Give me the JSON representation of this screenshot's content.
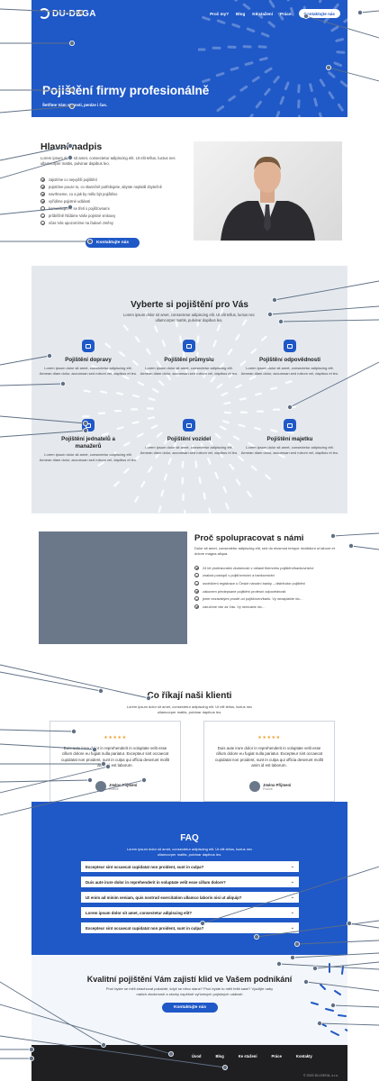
{
  "brand": {
    "name": "DU-DEGA"
  },
  "nav": {
    "items": [
      "Proč my?",
      "Blog",
      "Ke stažení",
      "Práce"
    ],
    "cta": "Kontaktujte nás"
  },
  "hero": {
    "title": "Pojištění firmy profesionálně",
    "subtitle": "Šetříme Vám starosti, peníze i čas."
  },
  "intro": {
    "title": "Hlavní nadpis",
    "lead": "Lorem ipsum dolor sit amet, consectetur adipiscing elit. Ut elit tellus, luctus nec ullamcorper mattis, pulvinar dapibus leo.",
    "checks": [
      "zajistíme co nejvyšší pojištění",
      "pojistíme pouze to, co skutečně potřebujete, abyste neplatili zbytečně",
      "navrhneme, co a jak by mělo být pojištěno",
      "vyřídíme pojistné události",
      "komunikujeme se třetí s pojišťovnami",
      "průběžně hlídáme Vaše pojistné smlouvy",
      "včas Vás upozorníme na řadové změny"
    ],
    "cta": "Kontaktujte nás"
  },
  "services": {
    "title": "Vyberte si pojištění pro Vás",
    "lead": "Lorem ipsum dolor sit amet, consectetur adipiscing elit. Ut elit tellus, luctus nec ullamcorper mattis, pulvinar dapibus leo.",
    "items": [
      {
        "title": "Pojištění dopravy",
        "text": "Lorem ipsum dolor sit amet, consectetur adipiscing elit. Aenean diam dolor, accumsan sed rutrum vel, dapibus et leo."
      },
      {
        "title": "Pojištění průmyslu",
        "text": "Lorem ipsum dolor sit amet, consectetur adipiscing elit. Aenean diam dolor, accumsan sed rutrum vel, dapibus et leo."
      },
      {
        "title": "Pojištění odpovědnosti",
        "text": "Lorem ipsum dolor sit amet, consectetur adipiscing elit. Aenean diam dolor, accumsan sed rutrum vel, dapibus et leo."
      },
      {
        "title": "Pojištění jednatelů a manažerů",
        "text": "Lorem ipsum dolor sit amet, consectetur adipiscing elit. Aenean diam dolor, accumsan sed rutrum vel, dapibus et leo."
      },
      {
        "title": "Pojištění vozidel",
        "text": "Lorem ipsum dolor sit amet, consectetur adipiscing elit. Aenean diam dolor, accumsan sed rutrum vel, dapibus et leo."
      },
      {
        "title": "Pojištění majetku",
        "text": "Lorem ipsum dolor sit amet, consectetur adipiscing elit. Aenean diam dolor, accumsan sed rutrum vel, dapibus et leo."
      }
    ]
  },
  "why": {
    "title": "Proč spolupracovat s námi",
    "lead": "Dolor sit amet, consectetur adipiscing elit, sed do eiusmod tempor incididunt ut labore et dolore magna aliqua.",
    "checks": [
      "24 let profesionální zkušeností v oblasti firemního pojištění/bankovnictví",
      "znalost postupů v pojišťovnictví a bankovnictví",
      "osvědčení registrace u České národní banky – distributor pojištění",
      "zákonem předepsané pojištění profesní odpovědnosti",
      "jsme nezávislými prostě od pojišťoven/bank. Vy nezaplatíte nic…",
      "zaručíme vše za Vás. Vy nemusíte nic…"
    ]
  },
  "testimonials": {
    "title": "Co říkají naši klienti",
    "lead": "Lorem ipsum dolor sit amet, consectetur adipiscing elit. Ut elit tellus, luctus nec ullamcorper mattis, pulvinar dapibus leo.",
    "cards": [
      {
        "stars": "★★★★★",
        "quote": "Duis aute irure dolor in reprehenderit in voluptate velit esse cillum dolore eu fugiat nulla pariatur. Excepteur sint occaecat cupidatat non proident, sunt in culpa qui officia deserunt mollit anim id est laborum.",
        "name": "Jméno Příjmení",
        "role": "Pozice"
      },
      {
        "stars": "★★★★★",
        "quote": "Duis aute irure dolor in reprehenderit in voluptate velit esse cillum dolore eu fugiat nulla pariatur. Excepteur sint occaecat cupidatat non proident, sunt in culpa qui officia deserunt mollit anim id est laborum.",
        "name": "Jméno Příjmení",
        "role": "Pozice"
      }
    ]
  },
  "faq": {
    "title": "FAQ",
    "lead": "Lorem ipsum dolor sit amet, consectetur adipiscing elit. Ut elit tellus, luctus nec ullamcorper mattis, pulvinar dapibus leo.",
    "items": [
      "Excepteur sint occaecat cupidatat non proident, sunt in culpa?",
      "Duis aute irure dolor in reprehenderit in voluptate velit esse cillum dolore?",
      "Ut enim ad minim veniam, quis nostrud exercitation ullamco laboris nisi ut aliquip?",
      "Lorem ipsum dolor sit amet, consectetur adipiscing elit?",
      "Excepteur sint occaecat cupidatat non proident, sunt in culpa?"
    ],
    "chevron": "⌄"
  },
  "cta": {
    "title": "Kvalitní pojištění Vám zajistí klid ve Vašem podnikání",
    "lead": "Proč byste se měli strachovat pokaždé, když se něco stane? Proč byste to měli řešit sami? Využijte naby našich zkušeností a stovky úspěšně vyřízených pojistných událostí",
    "button": "Kontaktujte nás"
  },
  "footer": {
    "nav": [
      "Úvod",
      "Blog",
      "Ke stažení",
      "Práce",
      "Kontakty"
    ],
    "copyright": "© 2022 DU-DEGA, s.r.o."
  },
  "colors": {
    "primary": "#1f58c7",
    "light_bg": "#e5e9ee",
    "dark": "#1f1f21",
    "pin": "#607085"
  }
}
